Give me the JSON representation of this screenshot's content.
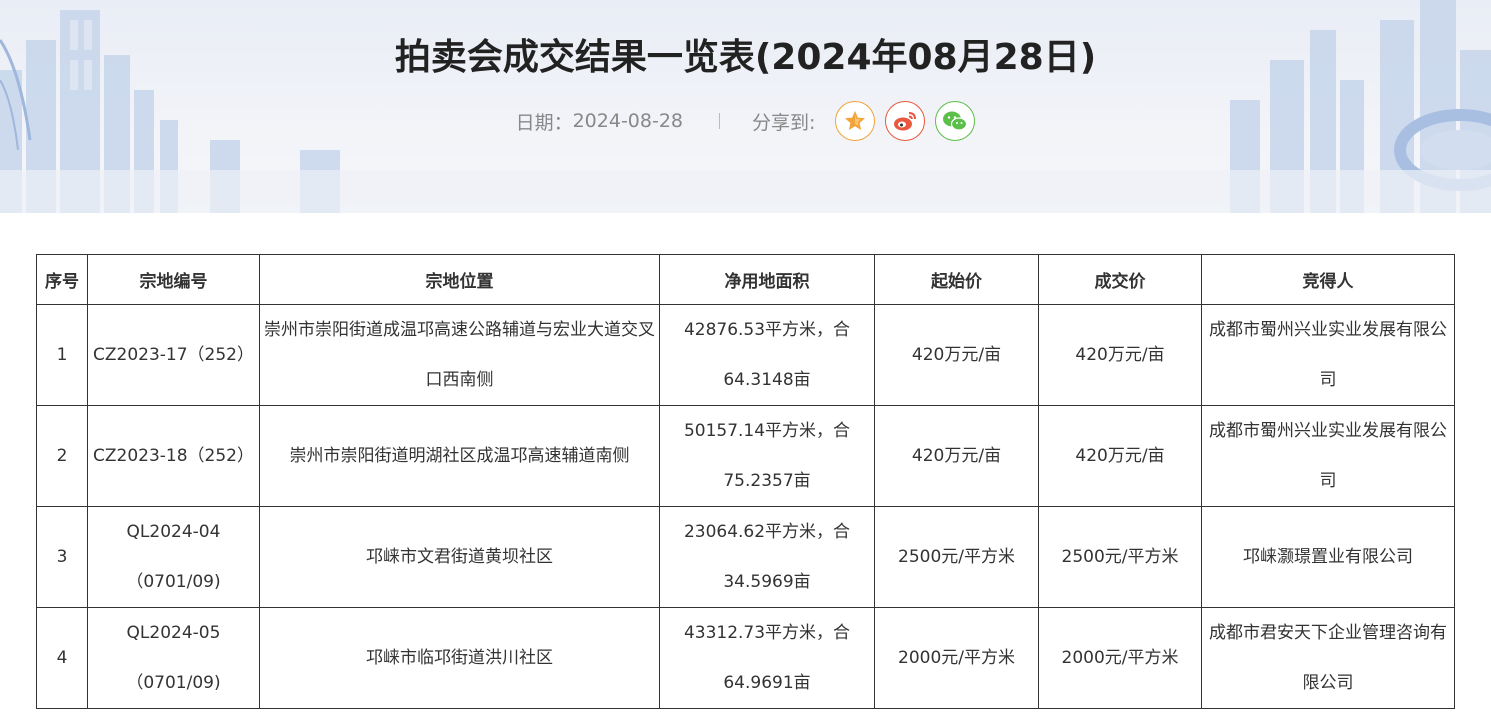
{
  "page": {
    "title": "拍卖会成交结果一览表(2024年08月28日)",
    "date_label": "日期：",
    "date_value": "2024-08-28",
    "separator": "|",
    "share_label": "分享到:",
    "share_buttons": [
      {
        "icon": "favorite-star-icon",
        "color": "#f2a43a"
      },
      {
        "icon": "weibo-icon",
        "color": "#e9583f"
      },
      {
        "icon": "wechat-icon",
        "color": "#5cbf4a"
      }
    ]
  },
  "table": {
    "headers": [
      "序号",
      "宗地编号",
      "宗地位置",
      "净用地面积",
      "起始价",
      "成交价",
      "竞得人"
    ],
    "rows": [
      {
        "no": "1",
        "code": "CZ2023-17（252）",
        "location": "崇州市崇阳街道成温邛高速公路辅道与宏业大道交叉口西南侧",
        "area": "42876.53平方米，合64.3148亩",
        "start_price": "420万元/亩",
        "deal_price": "420万元/亩",
        "winner": "成都市蜀州兴业实业发展有限公司"
      },
      {
        "no": "2",
        "code": "CZ2023-18（252）",
        "location": "崇州市崇阳街道明湖社区成温邛高速辅道南侧",
        "area": "50157.14平方米，合75.2357亩",
        "start_price": "420万元/亩",
        "deal_price": "420万元/亩",
        "winner": "成都市蜀州兴业实业发展有限公司"
      },
      {
        "no": "3",
        "code": "QL2024-04（0701/09)",
        "location": "邛崃市文君街道黄坝社区",
        "area": "23064.62平方米，合34.5969亩",
        "start_price": "2500元/平方米",
        "deal_price": "2500元/平方米",
        "winner": "邛崃灏璟置业有限公司"
      },
      {
        "no": "4",
        "code": "QL2024-05（0701/09)",
        "location": "邛崃市临邛街道洪川社区",
        "area": "43312.73平方米，合64.9691亩",
        "start_price": "2000元/平方米",
        "deal_price": "2000元/平方米",
        "winner": "成都市君安天下企业管理咨询有限公司"
      }
    ]
  }
}
